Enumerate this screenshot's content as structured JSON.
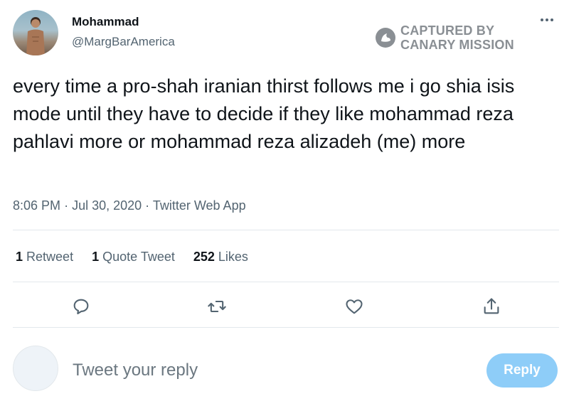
{
  "author": {
    "name": "Mohammad",
    "handle": "@MargBarAmerica",
    "avatar_icon": "user-photo-avatar"
  },
  "watermark": {
    "line1": "CAPTURED BY",
    "line2": "CANARY MISSION",
    "icon": "canary-bird-icon"
  },
  "more_icon": "more-dots-icon",
  "tweet": {
    "text": "every time a pro-shah iranian thirst follows me i go shia isis mode until they have to decide if they like mohammad reza pahlavi more or mohammad reza alizadeh (me) more",
    "time": "8:06 PM",
    "separator": "·",
    "date": "Jul 30, 2020",
    "source": "Twitter Web App"
  },
  "stats": {
    "retweets_count": "1",
    "retweets_label": "Retweet",
    "quotes_count": "1",
    "quotes_label": "Quote Tweet",
    "likes_count": "252",
    "likes_label": "Likes"
  },
  "actions": [
    "reply-icon",
    "retweet-icon",
    "like-icon",
    "share-icon"
  ],
  "reply_box": {
    "placeholder": "Tweet your reply",
    "button_label": "Reply"
  },
  "colors": {
    "text_primary": "#0f1419",
    "text_secondary": "#536471",
    "reply_button_bg": "#8ecdf8",
    "watermark": "#8a8f94",
    "divider": "#e3e8ec"
  }
}
